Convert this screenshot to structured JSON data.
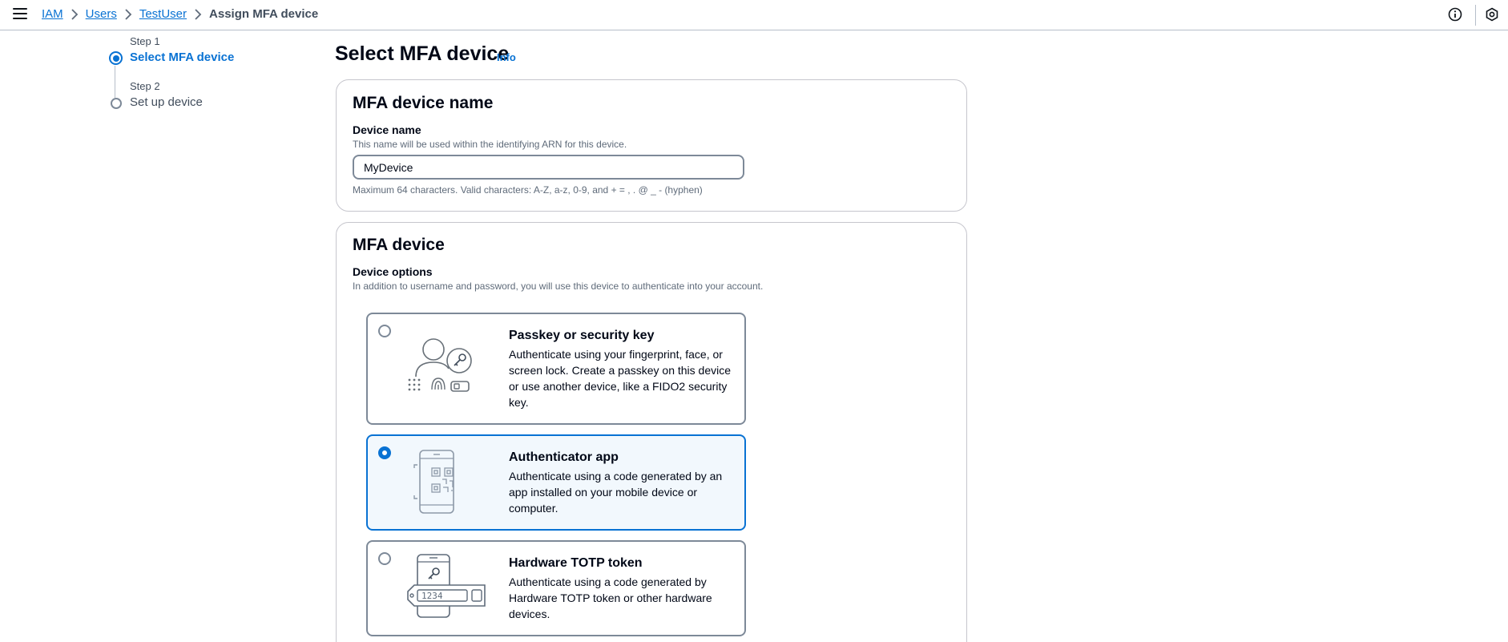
{
  "breadcrumb": {
    "items": [
      "IAM",
      "Users",
      "TestUser"
    ],
    "current": "Assign MFA device"
  },
  "top_icons": [
    "info-circle-icon",
    "settings-hexagon-icon"
  ],
  "steps": [
    {
      "label": "Step 1",
      "title": "Select MFA device",
      "state": "active"
    },
    {
      "label": "Step 2",
      "title": "Set up device",
      "state": "inactive"
    }
  ],
  "page": {
    "title": "Select MFA device",
    "info_link": "Info"
  },
  "device_name_panel": {
    "title": "MFA device name",
    "field_label": "Device name",
    "field_description": "This name will be used within the identifying ARN for this device.",
    "value": "MyDevice",
    "constraint": "Maximum 64 characters. Valid characters: A-Z, a-z, 0-9, and + = , . @ _ - (hyphen)"
  },
  "mfa_device_panel": {
    "title": "MFA device",
    "field_label": "Device options",
    "field_description": "In addition to username and password, you will use this device to authenticate into your account.",
    "options": [
      {
        "title": "Passkey or security key",
        "description": "Authenticate using your fingerprint, face, or screen lock. Create a passkey on this device or use another device, like a FIDO2 security key.",
        "selected": false,
        "icon": "passkey-illustration"
      },
      {
        "title": "Authenticator app",
        "description": "Authenticate using a code generated by an app installed on your mobile device or computer.",
        "selected": true,
        "icon": "authenticator-app-illustration"
      },
      {
        "title": "Hardware TOTP token",
        "description": "Authenticate using a code generated by Hardware TOTP token or other hardware devices.",
        "selected": false,
        "icon": "hardware-token-illustration",
        "token_digits": "1234"
      }
    ]
  },
  "colors": {
    "link": "#0972d3",
    "selected_bg": "#f2f8fd",
    "border": "#7d8998"
  }
}
